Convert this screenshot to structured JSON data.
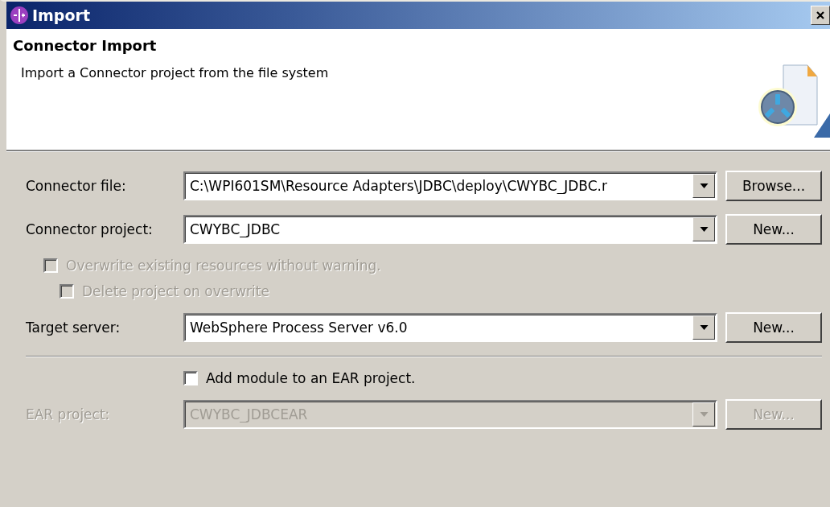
{
  "window": {
    "title": "Import"
  },
  "header": {
    "title": "Connector Import",
    "description": "Import a Connector project from the file system"
  },
  "form": [
    {
      "kind": "combo",
      "label": "Connector file:",
      "value": "C:\\WPI601SM\\Resource Adapters\\JDBC\\deploy\\CWYBC_JDBC.r",
      "button": "Browse...",
      "disabled": false
    },
    {
      "kind": "combo",
      "label": "Connector project:",
      "value": "CWYBC_JDBC",
      "button": "New...",
      "disabled": false
    },
    {
      "kind": "checkbox",
      "label": "Overwrite existing resources without warning.",
      "checked": false,
      "disabled": true,
      "children": [
        {
          "label": "Delete project on overwrite",
          "checked": false,
          "disabled": true
        }
      ]
    },
    {
      "kind": "combo",
      "label": "Target server:",
      "value": "WebSphere Process Server v6.0",
      "button": "New...",
      "disabled": false
    },
    {
      "kind": "separator"
    },
    {
      "kind": "field-checkbox",
      "label": "Add module to an EAR project.",
      "checked": false,
      "disabled": false
    },
    {
      "kind": "combo",
      "label": "EAR project:",
      "value": "CWYBC_JDBCEAR",
      "button": "New...",
      "disabled": true
    }
  ]
}
